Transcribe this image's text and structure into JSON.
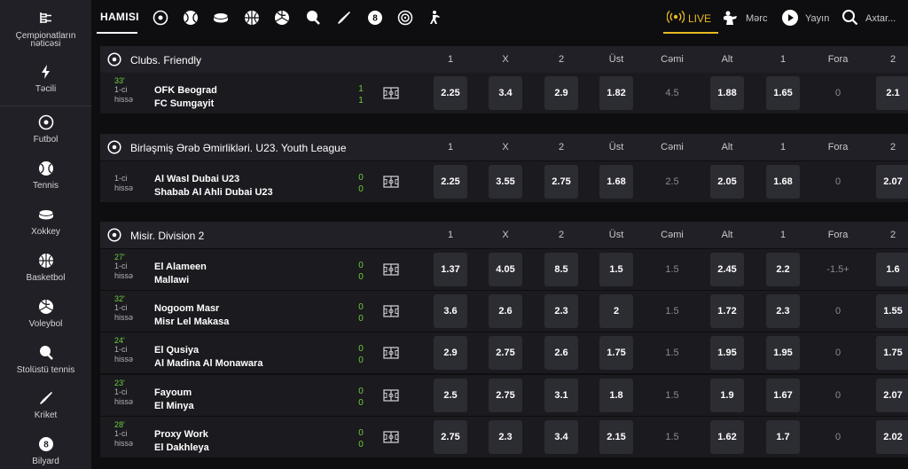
{
  "sidebar": {
    "items": [
      {
        "label": "Çempionatların nəticəsi",
        "icon": "results-icon"
      },
      {
        "label": "Təcili",
        "icon": "lightning-icon"
      },
      {
        "label": "Futbol",
        "icon": "soccer-icon"
      },
      {
        "label": "Tennis",
        "icon": "tennis-icon"
      },
      {
        "label": "Xokkey",
        "icon": "hockey-icon"
      },
      {
        "label": "Basketbol",
        "icon": "basketball-icon"
      },
      {
        "label": "Voleybol",
        "icon": "volleyball-icon"
      },
      {
        "label": "Stolüstü tennis",
        "icon": "table-tennis-icon"
      },
      {
        "label": "Kriket",
        "icon": "cricket-icon"
      },
      {
        "label": "Bilyard",
        "icon": "billiards-icon"
      }
    ]
  },
  "topbar": {
    "all_label": "HAMISI",
    "sport_icons": [
      "soccer-icon",
      "tennis-icon",
      "hockey-icon",
      "basketball-icon",
      "volleyball-icon",
      "table-tennis-icon",
      "cricket-icon",
      "billiards-icon",
      "darts-icon",
      "esports-icon"
    ],
    "live_label": "LIVE",
    "match_label": "Mərc",
    "stream_label": "Yayın",
    "search_placeholder": "Axtar..."
  },
  "colors": {
    "accent": "#e8b923",
    "live_green": "#6fcf3d",
    "panel": "#202026",
    "odd_bg": "#2c2c33"
  },
  "column_headers": [
    "1",
    "X",
    "2",
    "Üst",
    "Cəmi",
    "Alt",
    "1",
    "Fora",
    "2"
  ],
  "leagues": [
    {
      "name": "Clubs. Friendly",
      "matches": [
        {
          "minute": "33'",
          "half_a": "1-ci",
          "half_b": "hissə",
          "team1": "OFK Beograd",
          "team2": "FC Sumgayit",
          "score1": "1",
          "score2": "1",
          "odds": [
            "2.25",
            "3.4",
            "2.9",
            "1.82",
            "4.5",
            "1.88",
            "1.65",
            "0",
            "2.1"
          ]
        }
      ]
    },
    {
      "name": "Birləşmiş Ərəb Əmirlikləri. U23. Youth League",
      "matches": [
        {
          "minute": "",
          "half_a": "1-ci",
          "half_b": "hissə",
          "team1": "Al Wasl Dubai U23",
          "team2": "Shabab Al Ahli Dubai U23",
          "score1": "0",
          "score2": "0",
          "odds": [
            "2.25",
            "3.55",
            "2.75",
            "1.68",
            "2.5",
            "2.05",
            "1.68",
            "0",
            "2.07"
          ]
        }
      ]
    },
    {
      "name": "Misir. Division 2",
      "matches": [
        {
          "minute": "27'",
          "half_a": "1-ci",
          "half_b": "hissə",
          "team1": "El Alameen",
          "team2": "Mallawi",
          "score1": "0",
          "score2": "0",
          "odds": [
            "1.37",
            "4.05",
            "8.5",
            "1.5",
            "1.5",
            "2.45",
            "2.2",
            "-1.5+",
            "1.6"
          ]
        },
        {
          "minute": "32'",
          "half_a": "1-ci",
          "half_b": "hissə",
          "team1": "Nogoom Masr",
          "team2": "Misr Lel Makasa",
          "score1": "0",
          "score2": "0",
          "odds": [
            "3.6",
            "2.6",
            "2.3",
            "2",
            "1.5",
            "1.72",
            "2.3",
            "0",
            "1.55"
          ]
        },
        {
          "minute": "24'",
          "half_a": "1-ci",
          "half_b": "hissə",
          "team1": "El Qusiya",
          "team2": "Al Madina Al Monawara",
          "score1": "0",
          "score2": "0",
          "odds": [
            "2.9",
            "2.75",
            "2.6",
            "1.75",
            "1.5",
            "1.95",
            "1.95",
            "0",
            "1.75"
          ]
        },
        {
          "minute": "23'",
          "half_a": "1-ci",
          "half_b": "hissə",
          "team1": "Fayoum",
          "team2": "El Minya",
          "score1": "0",
          "score2": "0",
          "odds": [
            "2.5",
            "2.75",
            "3.1",
            "1.8",
            "1.5",
            "1.9",
            "1.67",
            "0",
            "2.07"
          ]
        },
        {
          "minute": "28'",
          "half_a": "1-ci",
          "half_b": "hissə",
          "team1": "Proxy Work",
          "team2": "El Dakhleya",
          "score1": "0",
          "score2": "0",
          "odds": [
            "2.75",
            "2.3",
            "3.4",
            "2.15",
            "1.5",
            "1.62",
            "1.7",
            "0",
            "2.02"
          ]
        }
      ]
    }
  ]
}
